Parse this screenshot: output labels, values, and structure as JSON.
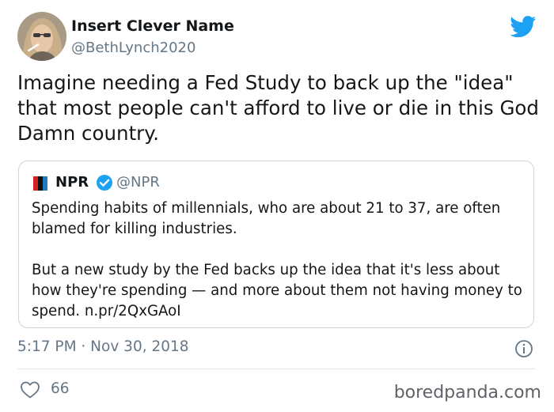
{
  "tweet": {
    "display_name": "Insert Clever Name",
    "handle": "@BethLynch2020",
    "text": "Imagine needing a Fed Study to back up the \"idea\" that most people can't afford to live or die in this God Damn country.",
    "timestamp": "5:17 PM · Nov 30, 2018",
    "like_count": "66"
  },
  "quoted": {
    "name": "NPR",
    "handle": "@NPR",
    "logo_text": "n",
    "paragraph_1": "Spending habits of millennials, who are about 21 to 37, are often blamed for killing industries.",
    "paragraph_2": "But a new study by the Fed backs up the idea that it's less about how they're spending — and more about them not having money to spend. n.pr/2QxGAoI"
  },
  "watermark": "boredpanda.com",
  "colors": {
    "twitter_blue": "#1da1f2",
    "secondary_text": "#657786",
    "border": "#ccd6dd",
    "npr_red": "#d62021",
    "npr_black": "#111111",
    "npr_blue": "#237bbd"
  },
  "icons": {
    "brand": "twitter-bird-icon",
    "verified": "verified-badge-icon",
    "info": "info-icon",
    "like": "heart-icon"
  }
}
